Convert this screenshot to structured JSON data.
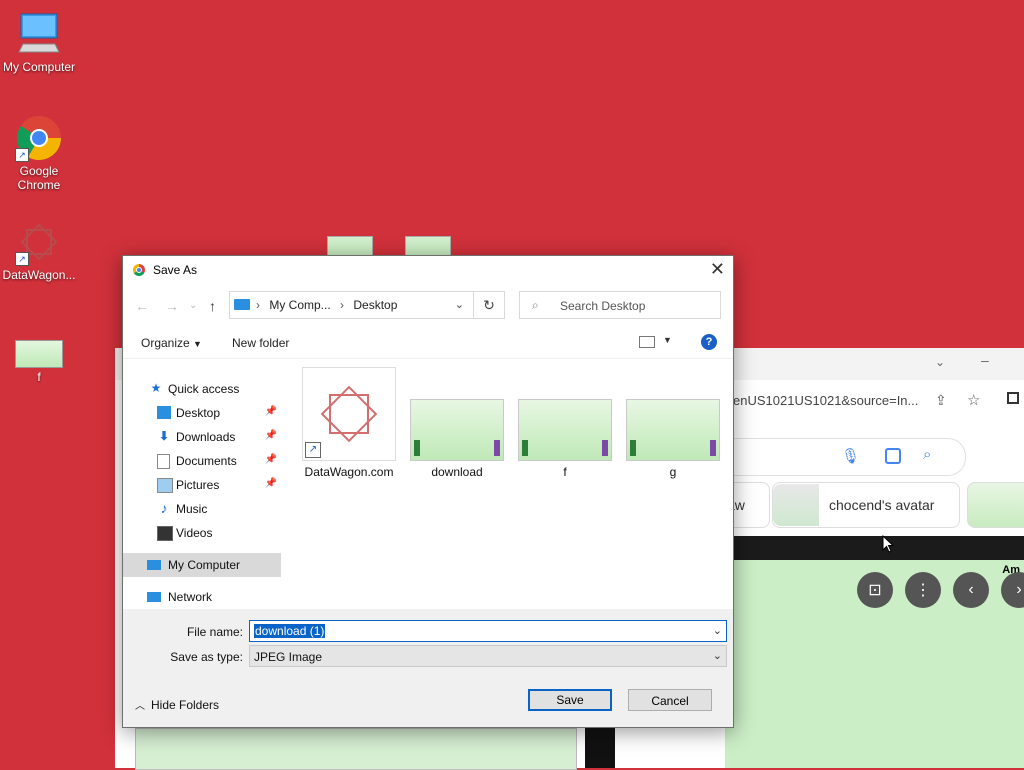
{
  "desktop": {
    "icons": [
      {
        "label": "My Computer"
      },
      {
        "label": "Google Chrome"
      },
      {
        "label": "DataWagon..."
      },
      {
        "label": "f"
      }
    ]
  },
  "browser_bg": {
    "url_fragment": "enUS1021US1021&source=In...",
    "chips": [
      "aw",
      "chocend's avatar"
    ],
    "image_caption": "Am"
  },
  "dialog": {
    "title": "Save As",
    "breadcrumb": [
      "My Comp...",
      "Desktop"
    ],
    "search_placeholder": "Search Desktop",
    "toolbar": {
      "organize": "Organize",
      "new_folder": "New folder",
      "help": "?"
    },
    "nav": {
      "quick_access": "Quick access",
      "items": [
        {
          "label": "Desktop",
          "pinned": true
        },
        {
          "label": "Downloads",
          "pinned": true
        },
        {
          "label": "Documents",
          "pinned": true
        },
        {
          "label": "Pictures",
          "pinned": true
        },
        {
          "label": "Music",
          "pinned": false
        },
        {
          "label": "Videos",
          "pinned": false
        }
      ],
      "my_computer": "My Computer",
      "network": "Network"
    },
    "files": [
      {
        "name": "DataWagon.com"
      },
      {
        "name": "download"
      },
      {
        "name": "f"
      },
      {
        "name": "g"
      }
    ],
    "file_name_label": "File name:",
    "file_name_value": "download (1)",
    "save_type_label": "Save as type:",
    "save_type_value": "JPEG Image",
    "hide_folders": "Hide Folders",
    "save_button": "Save",
    "cancel_button": "Cancel"
  }
}
